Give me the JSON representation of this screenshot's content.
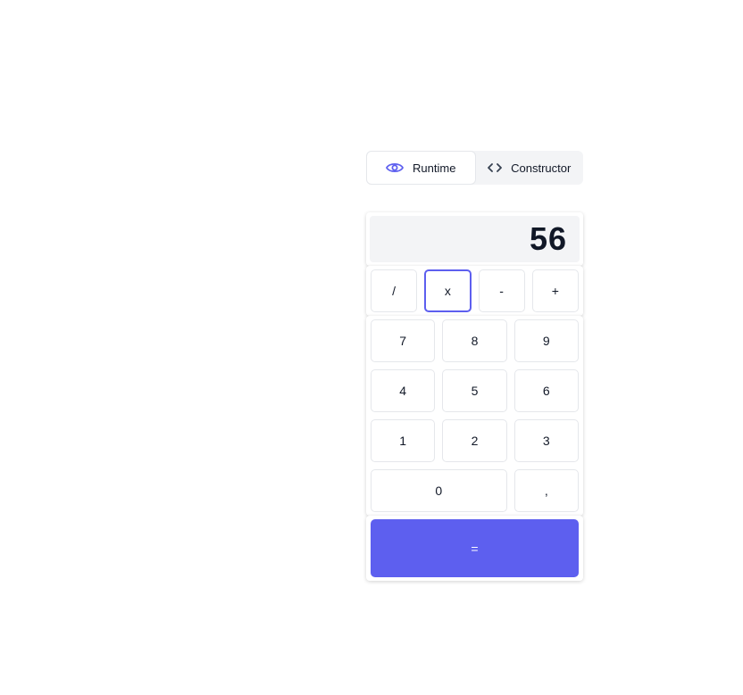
{
  "mode_toggle": {
    "runtime_label": "Runtime",
    "constructor_label": "Constructor",
    "active": "Runtime",
    "runtime_icon": "eye-icon",
    "constructor_icon": "code-icon"
  },
  "calculator": {
    "display_value": "56",
    "operators": [
      "/",
      "x",
      "-",
      "+"
    ],
    "selected_operator": "x",
    "digits": [
      "7",
      "8",
      "9",
      "4",
      "5",
      "6",
      "1",
      "2",
      "3",
      "0",
      ","
    ],
    "equals_label": "="
  },
  "colors": {
    "accent": "#5d5fef",
    "display_bg": "#f3f4f6",
    "border": "#e5e7eb",
    "text": "#111827"
  }
}
